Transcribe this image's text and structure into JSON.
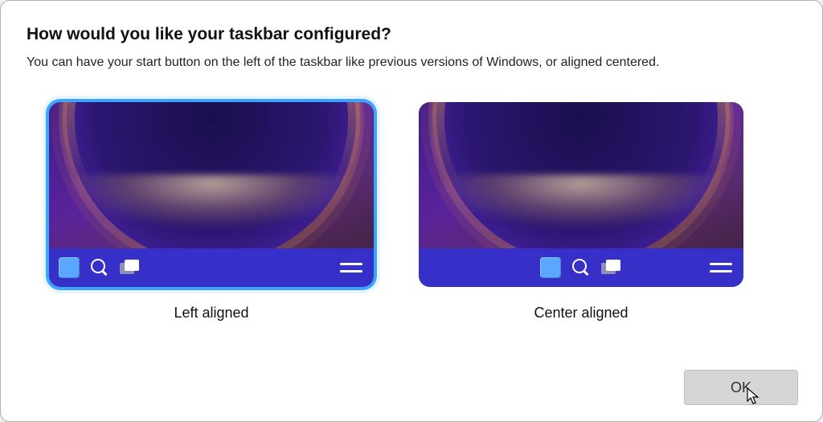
{
  "title": "How would you like your taskbar configured?",
  "subtitle": "You can have your start button on the left of the taskbar like previous versions of Windows, or aligned centered.",
  "options": {
    "left": {
      "label": "Left aligned",
      "selected": true
    },
    "center": {
      "label": "Center aligned",
      "selected": false
    }
  },
  "buttons": {
    "ok": "OK"
  }
}
